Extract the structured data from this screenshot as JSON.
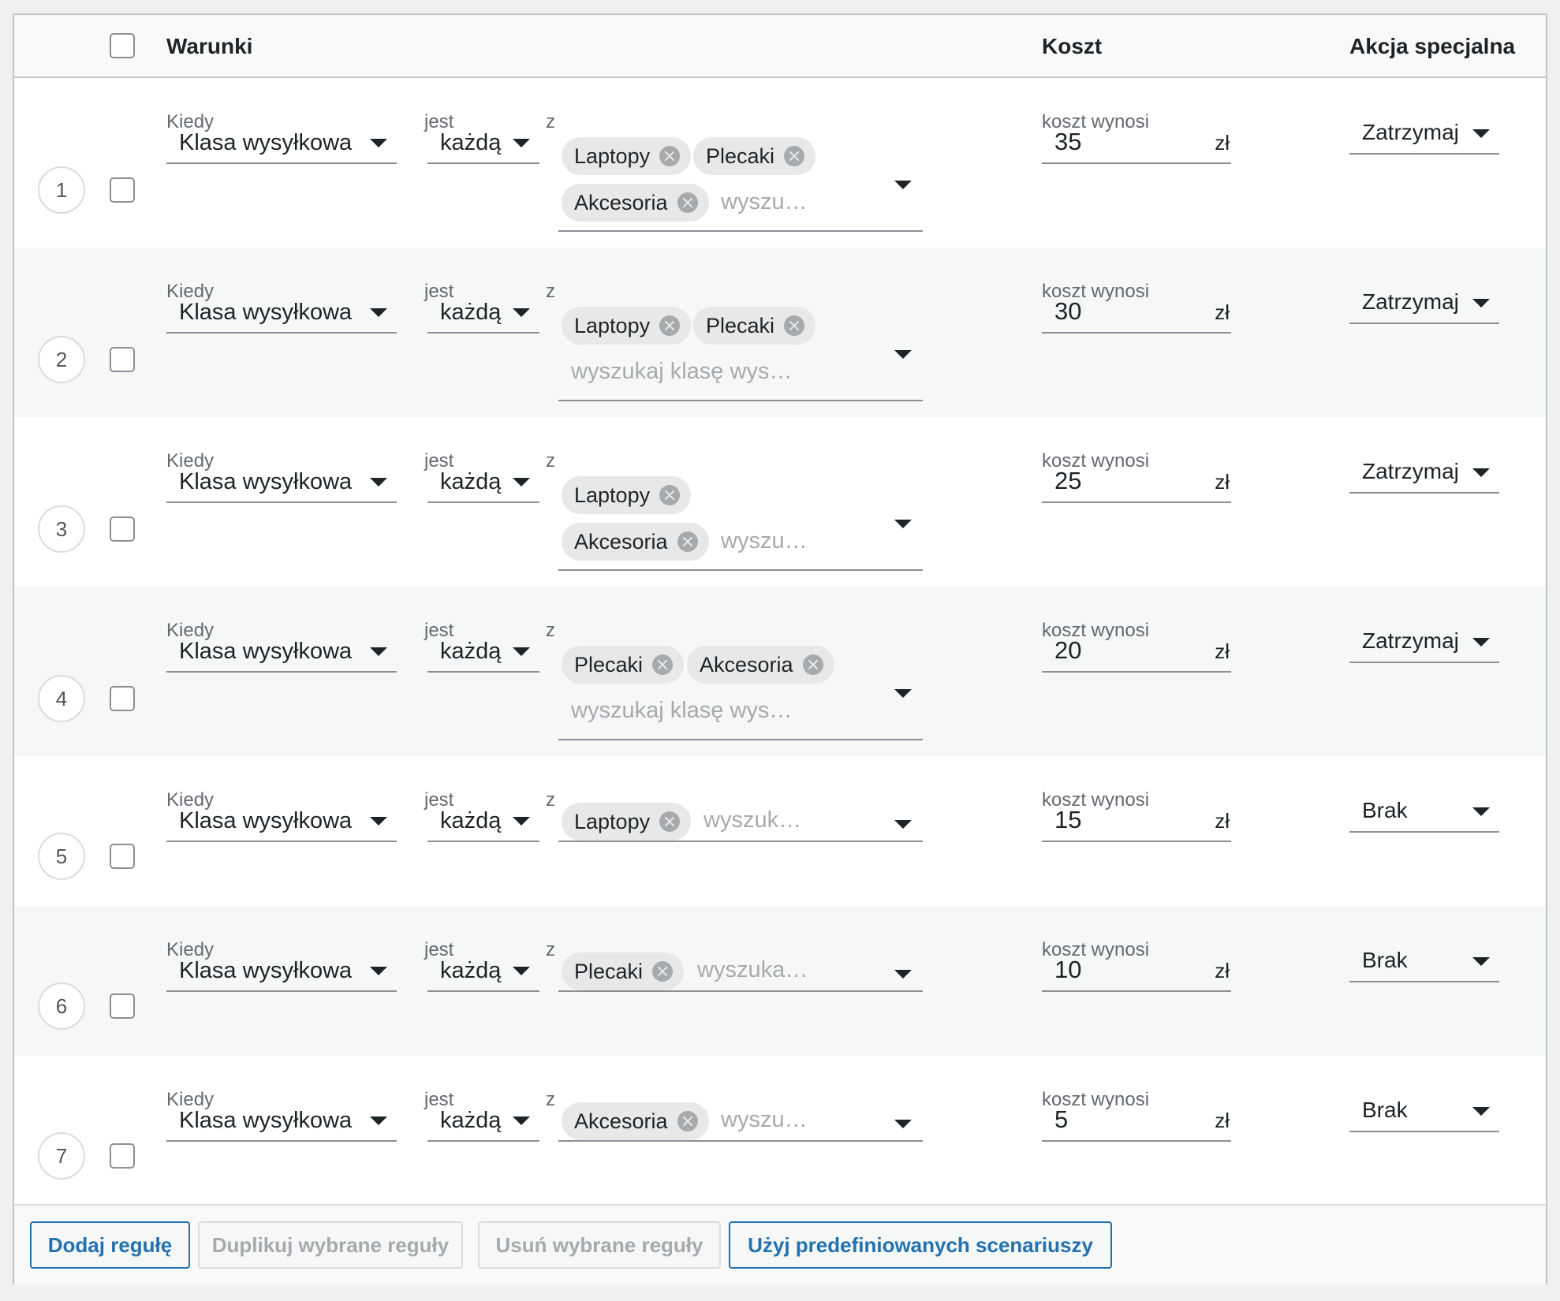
{
  "header": {
    "conditions": "Warunki",
    "cost": "Koszt",
    "special_action": "Akcja specjalna"
  },
  "labels": {
    "when": "Kiedy",
    "is": "jest",
    "from": "z",
    "cost_is": "koszt wynosi",
    "currency": "zł"
  },
  "rules": [
    {
      "num": "1",
      "when": "Klasa wysyłkowa",
      "op": "każdą",
      "tags": [
        "Laptopy",
        "Plecaki",
        "Akcesoria"
      ],
      "placeholder": "wyszu…",
      "cost": "35",
      "action": "Zatrzymaj"
    },
    {
      "num": "2",
      "when": "Klasa wysyłkowa",
      "op": "każdą",
      "tags": [
        "Laptopy",
        "Plecaki"
      ],
      "placeholder": "wyszukaj klasę wys…",
      "cost": "30",
      "action": "Zatrzymaj"
    },
    {
      "num": "3",
      "when": "Klasa wysyłkowa",
      "op": "każdą",
      "tags": [
        "Laptopy",
        "Akcesoria"
      ],
      "placeholder": "wyszu…",
      "cost": "25",
      "action": "Zatrzymaj"
    },
    {
      "num": "4",
      "when": "Klasa wysyłkowa",
      "op": "każdą",
      "tags": [
        "Plecaki",
        "Akcesoria"
      ],
      "placeholder": "wyszukaj klasę wys…",
      "cost": "20",
      "action": "Zatrzymaj"
    },
    {
      "num": "5",
      "when": "Klasa wysyłkowa",
      "op": "każdą",
      "tags": [
        "Laptopy"
      ],
      "placeholder": "wyszuk…",
      "cost": "15",
      "action": "Brak"
    },
    {
      "num": "6",
      "when": "Klasa wysyłkowa",
      "op": "każdą",
      "tags": [
        "Plecaki"
      ],
      "placeholder": "wyszuka…",
      "cost": "10",
      "action": "Brak"
    },
    {
      "num": "7",
      "when": "Klasa wysyłkowa",
      "op": "każdą",
      "tags": [
        "Akcesoria"
      ],
      "placeholder": "wyszu…",
      "cost": "5",
      "action": "Brak"
    }
  ],
  "buttons": {
    "add_rule": "Dodaj regułę",
    "duplicate": "Duplikuj wybrane reguły",
    "delete": "Usuń wybrane reguły",
    "predefined": "Użyj predefiniowanych scenariuszy"
  }
}
